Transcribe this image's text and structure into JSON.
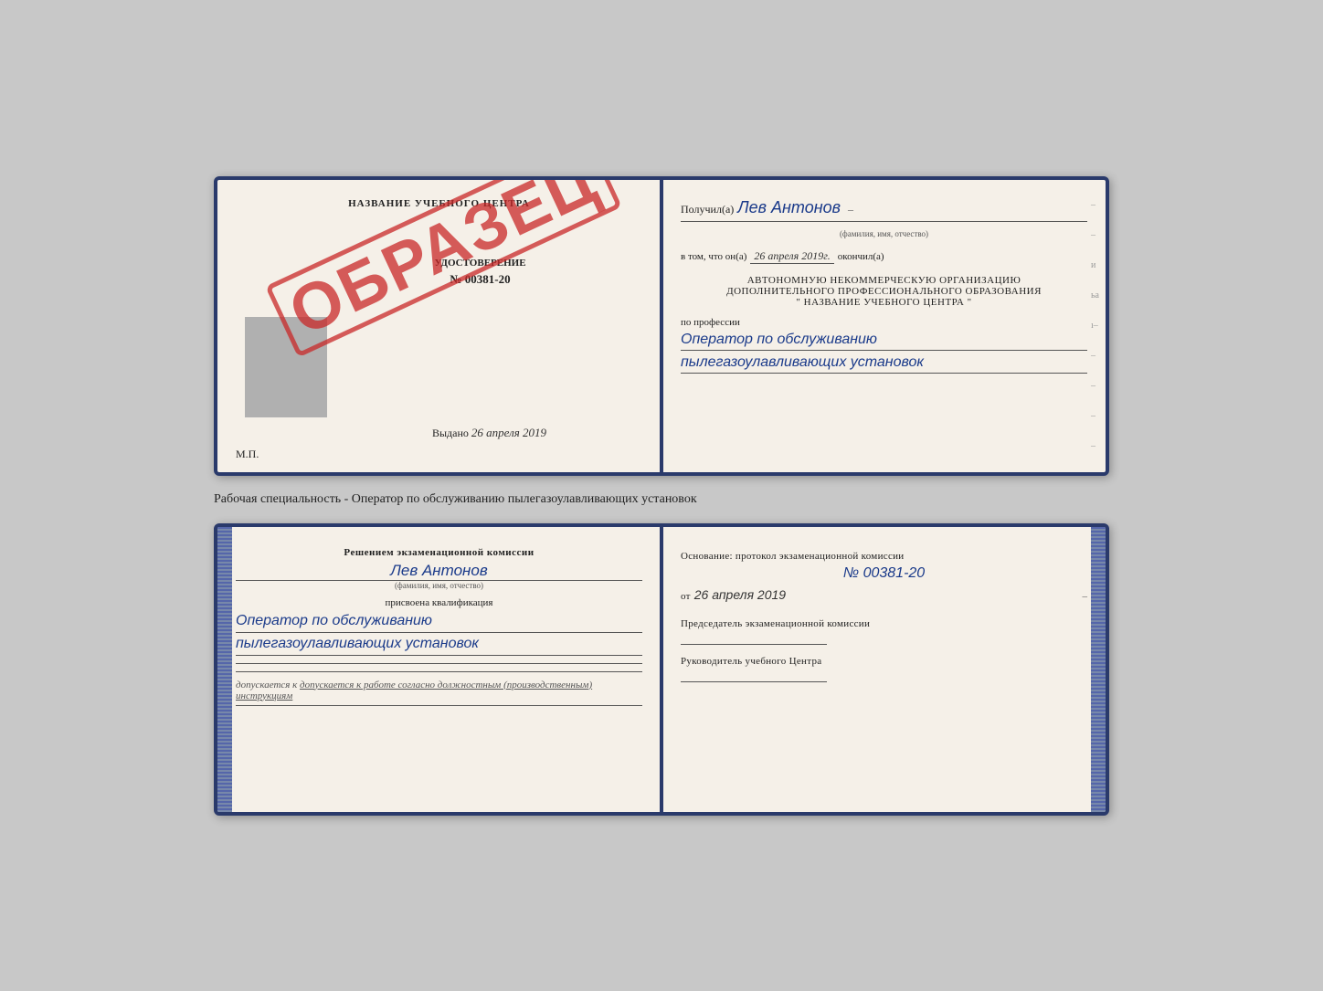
{
  "top_card": {
    "left": {
      "header": "НАЗВАНИЕ УЧЕБНОГО ЦЕНТРА",
      "stamp_text": "ОБРАЗЕЦ",
      "udost_label": "УДОСТОВЕРЕНИЕ",
      "cert_number": "№ 00381-20",
      "issued_label": "Выдано",
      "issued_date": "26 апреля 2019",
      "mp_label": "М.П."
    },
    "right": {
      "received_label": "Получил(а)",
      "recipient_name": "Лев Антонов",
      "name_sublabel": "(фамилия, имя, отчество)",
      "in_that_label": "в том, что он(а)",
      "completion_date": "26 апреля 2019г.",
      "finished_label": "окончил(а)",
      "org_line1": "АВТОНОМНУЮ НЕКОММЕРЧЕСКУЮ ОРГАНИЗАЦИЮ",
      "org_line2": "ДОПОЛНИТЕЛЬНОГО ПРОФЕССИОНАЛЬНОГО ОБРАЗОВАНИЯ",
      "org_line3": "\"   НАЗВАНИЕ УЧЕБНОГО ЦЕНТРА   \"",
      "profession_label": "по профессии",
      "profession_line1": "Оператор по обслуживанию",
      "profession_line2": "пылегазоулавливающих установок"
    }
  },
  "work_specialty": "Рабочая специальность - Оператор по обслуживанию пылегазоулавливающих установок",
  "bottom_card": {
    "left": {
      "heading": "Решением экзаменационной комиссии",
      "person_name": "Лев Антонов",
      "name_sublabel": "(фамилия, имя, отчество)",
      "qualification_label": "присвоена квалификация",
      "qual_line1": "Оператор по обслуживанию",
      "qual_line2": "пылегазоулавливающих установок",
      "admit_text": "допускается к  работе согласно должностным (производственным) инструкциям"
    },
    "right": {
      "basis_label": "Основание: протокол экзаменационной комиссии",
      "protocol_number": "№  00381-20",
      "protocol_date_prefix": "от",
      "protocol_date": "26 апреля 2019",
      "commission_chair_label": "Председатель экзаменационной комиссии",
      "school_director_label": "Руководитель учебного Центра"
    }
  }
}
